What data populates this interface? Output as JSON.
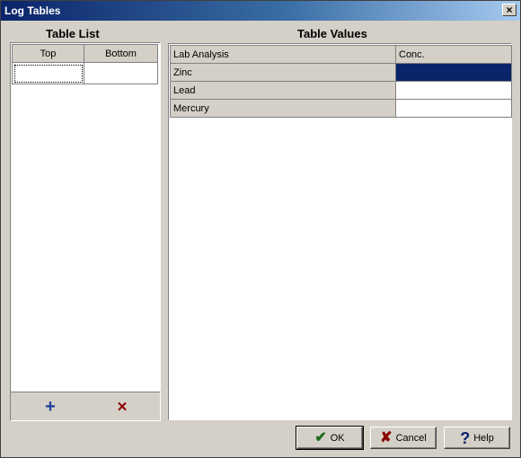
{
  "window": {
    "title": "Log Tables",
    "close_glyph": "×"
  },
  "table_list": {
    "title": "Table List",
    "columns": [
      "Top",
      "Bottom"
    ],
    "rows": [
      [
        "",
        ""
      ]
    ],
    "add_glyph": "+",
    "delete_glyph": "✕"
  },
  "table_values": {
    "title": "Table Values",
    "columns": [
      "Lab Analysis",
      "Conc."
    ],
    "rows": [
      {
        "analysis": "Zinc",
        "conc": ""
      },
      {
        "analysis": "Lead",
        "conc": ""
      },
      {
        "analysis": "Mercury",
        "conc": ""
      }
    ]
  },
  "buttons": {
    "ok": {
      "label": "OK",
      "icon": "✔"
    },
    "cancel": {
      "label": "Cancel",
      "icon": "✘"
    },
    "help": {
      "label": "Help",
      "icon": "?"
    }
  },
  "colors": {
    "selection": "#0a246a",
    "ok_icon": "#1a6b1a",
    "cancel_icon": "#8b0000",
    "help_icon": "#0a246a",
    "add_icon": "#1f3f99",
    "delete_icon": "#8b0000"
  }
}
